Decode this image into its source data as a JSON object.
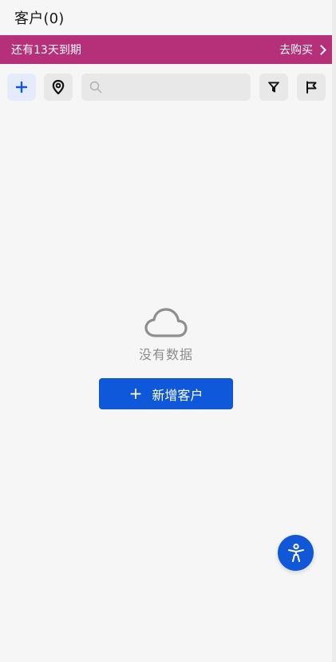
{
  "header": {
    "title": "客户(0)"
  },
  "banner": {
    "expiry_text": "还有13天到期",
    "buy_label": "去购买"
  },
  "toolbar": {
    "search_placeholder": "",
    "icons": [
      "plus-icon",
      "location-pin-icon",
      "search-icon",
      "filter-icon",
      "flag-icon"
    ]
  },
  "empty_state": {
    "icon": "cloud-icon",
    "message": "没有数据",
    "button_label": "新增客户"
  },
  "floating": {
    "icon": "accessibility-icon"
  },
  "colors": {
    "banner": "#b62f79",
    "primary": "#0e58d9",
    "add_button_bg": "#e6ebfb"
  }
}
